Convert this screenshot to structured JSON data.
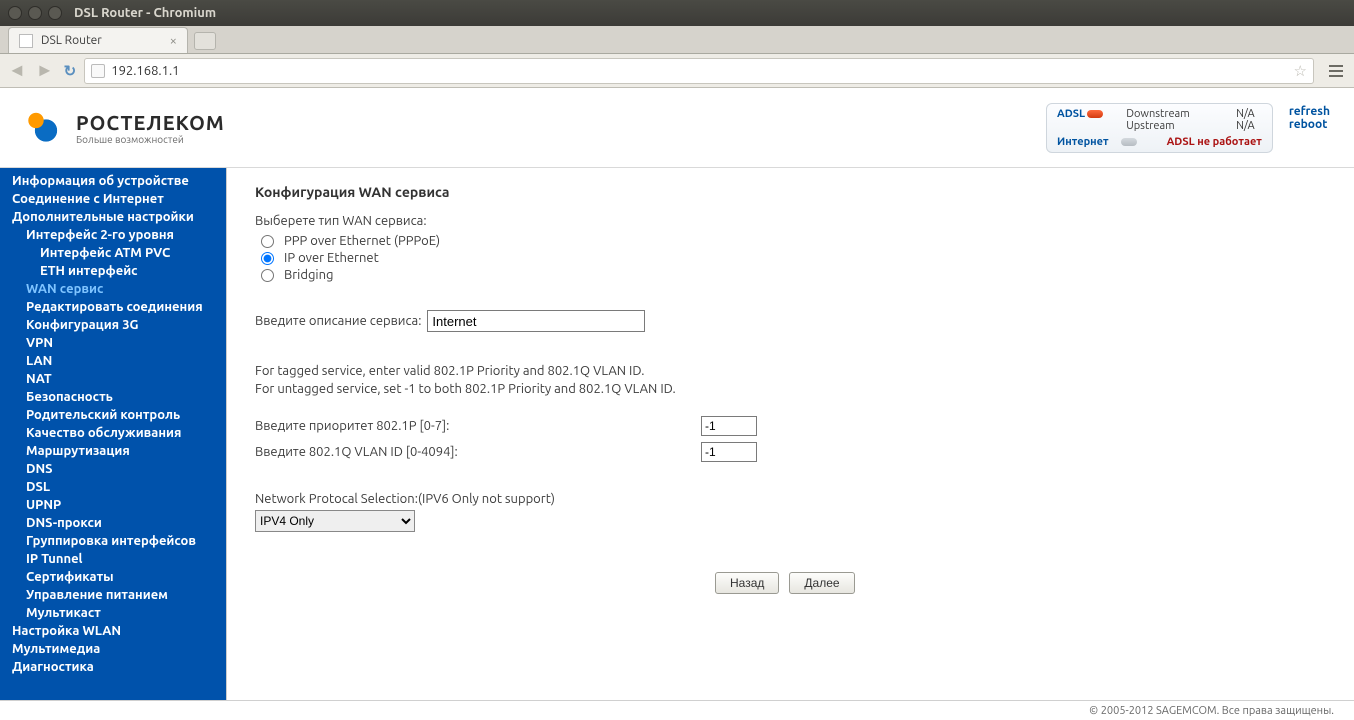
{
  "os": {
    "title": "DSL Router - Chromium"
  },
  "browser": {
    "tab_title": "DSL Router",
    "address": "192.168.1.1"
  },
  "brand": {
    "name": "РОСТЕЛЕКОМ",
    "tagline": "Больше возможностей"
  },
  "status": {
    "adsl_label": "ADSL",
    "down_label": "Downstream",
    "up_label": "Upstream",
    "down_val": "N/A",
    "up_val": "N/A",
    "inet_label": "Интернет",
    "adsl_err": "ADSL не работает",
    "refresh": "refresh",
    "reboot": "reboot"
  },
  "sidebar": {
    "items": [
      {
        "label": "Информация об устройстве",
        "lvl": 0
      },
      {
        "label": "Соединение с Интернет",
        "lvl": 0
      },
      {
        "label": "Дополнительные настройки",
        "lvl": 0
      },
      {
        "label": "Интерфейс 2-го уровня",
        "lvl": 1
      },
      {
        "label": "Интерфейс ATM PVC",
        "lvl": 2
      },
      {
        "label": "ETH интерфейс",
        "lvl": 2
      },
      {
        "label": "WAN сервис",
        "lvl": 1,
        "active": true
      },
      {
        "label": "Редактировать соединения",
        "lvl": 1
      },
      {
        "label": "Конфигурация 3G",
        "lvl": 1
      },
      {
        "label": "VPN",
        "lvl": 1
      },
      {
        "label": "LAN",
        "lvl": 1
      },
      {
        "label": "NAT",
        "lvl": 1
      },
      {
        "label": "Безопасность",
        "lvl": 1
      },
      {
        "label": "Родительский контроль",
        "lvl": 1
      },
      {
        "label": "Качество обслуживания",
        "lvl": 1
      },
      {
        "label": "Маршрутизация",
        "lvl": 1
      },
      {
        "label": "DNS",
        "lvl": 1
      },
      {
        "label": "DSL",
        "lvl": 1
      },
      {
        "label": "UPNP",
        "lvl": 1
      },
      {
        "label": "DNS-прокси",
        "lvl": 1
      },
      {
        "label": "Группировка интерфейсов",
        "lvl": 1
      },
      {
        "label": "IP Tunnel",
        "lvl": 1
      },
      {
        "label": "Сертификаты",
        "lvl": 1
      },
      {
        "label": "Управление питанием",
        "lvl": 1
      },
      {
        "label": "Мультикаст",
        "lvl": 1
      },
      {
        "label": "Настройка WLAN",
        "lvl": 0
      },
      {
        "label": "Мультимедиа",
        "lvl": 0
      },
      {
        "label": "Диагностика",
        "lvl": 0
      }
    ]
  },
  "form": {
    "heading": "Конфигурация WAN сервиса",
    "type_label": "Выберете тип WAN сервиса:",
    "opt_pppoe": "PPP over Ethernet (PPPoE)",
    "opt_ipoe": "IP over Ethernet",
    "opt_bridge": "Bridging",
    "desc_label": "Введите описание сервиса:",
    "desc_value": "Internet",
    "hint1": "For tagged service, enter valid 802.1P Priority and 802.1Q VLAN ID.",
    "hint2": "For untagged service, set -1 to both 802.1P Priority and 802.1Q VLAN ID.",
    "prio_label": "Введите приоритет 802.1P [0-7]:",
    "prio_value": "-1",
    "vlan_label": "Введите 802.1Q VLAN ID [0-4094]:",
    "vlan_value": "-1",
    "proto_label": "Network Protocal Selection:(IPV6 Only not support)",
    "proto_value": "IPV4 Only",
    "btn_back": "Назад",
    "btn_next": "Далее"
  },
  "footer": "© 2005-2012 SAGEMCOM. Все права защищены."
}
